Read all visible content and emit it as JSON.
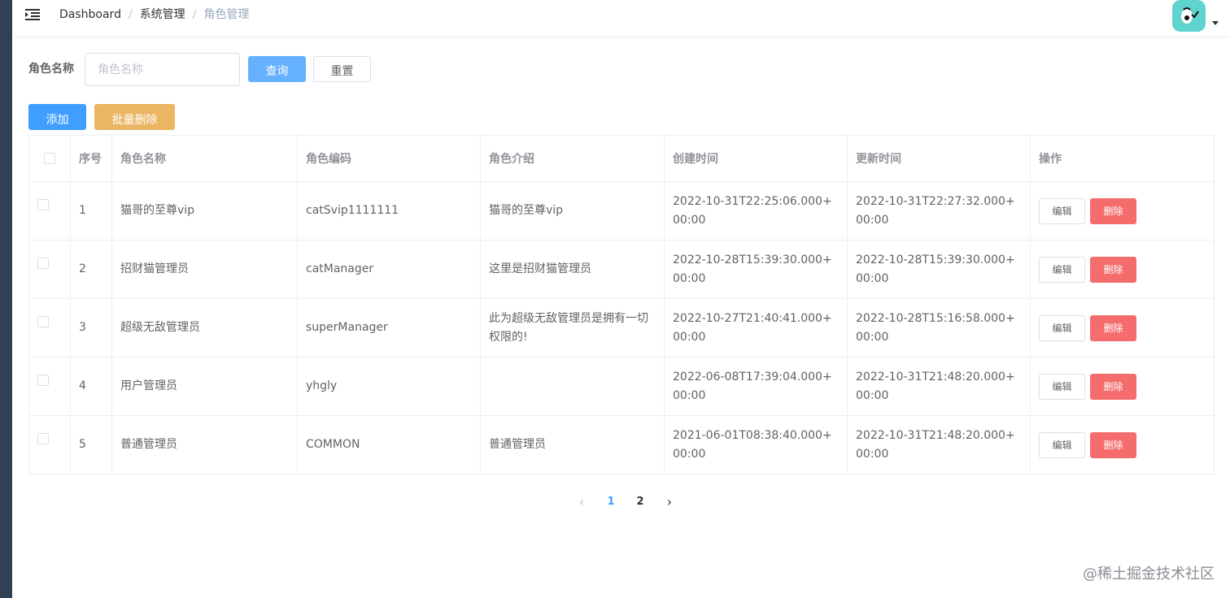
{
  "navbar": {
    "breadcrumb": [
      "Dashboard",
      "系统管理",
      "角色管理"
    ],
    "separator": "/"
  },
  "search": {
    "label": "角色名称",
    "placeholder": "角色名称",
    "value": "",
    "query_label": "查询",
    "reset_label": "重置"
  },
  "toolbar": {
    "add_label": "添加",
    "batch_delete_label": "批量删除"
  },
  "table": {
    "headers": [
      "序号",
      "角色名称",
      "角色编码",
      "角色介绍",
      "创建时间",
      "更新时间",
      "操作"
    ],
    "rows": [
      {
        "index": "1",
        "name": "猫哥的至尊vip",
        "code": "catSvip1111111",
        "desc": "猫哥的至尊vip",
        "created": "2022-10-31T22:25:06.000+00:00",
        "updated": "2022-10-31T22:27:32.000+00:00"
      },
      {
        "index": "2",
        "name": "招财猫管理员",
        "code": "catManager",
        "desc": "这里是招财猫管理员",
        "created": "2022-10-28T15:39:30.000+00:00",
        "updated": "2022-10-28T15:39:30.000+00:00"
      },
      {
        "index": "3",
        "name": "超级无敌管理员",
        "code": "superManager",
        "desc": "此为超级无敌管理员是拥有一切权限的!",
        "created": "2022-10-27T21:40:41.000+00:00",
        "updated": "2022-10-28T15:16:58.000+00:00"
      },
      {
        "index": "4",
        "name": "用户管理员",
        "code": "yhgly",
        "desc": "",
        "created": "2022-06-08T17:39:04.000+00:00",
        "updated": "2022-10-31T21:48:20.000+00:00"
      },
      {
        "index": "5",
        "name": "普通管理员",
        "code": "COMMON",
        "desc": "普通管理员",
        "created": "2021-06-01T08:38:40.000+00:00",
        "updated": "2022-10-31T21:48:20.000+00:00"
      }
    ],
    "edit_label": "编辑",
    "delete_label": "删除"
  },
  "pagination": {
    "pages": [
      "1",
      "2"
    ],
    "current": "1",
    "prev_icon": "‹",
    "next_icon": "›"
  },
  "watermark": "@稀土掘金技术社区",
  "colors": {
    "sidebar": "#304156",
    "primary": "#409eff",
    "warning": "#ebb563",
    "danger": "#f56c6c",
    "avatar": "#5fd3cd"
  }
}
